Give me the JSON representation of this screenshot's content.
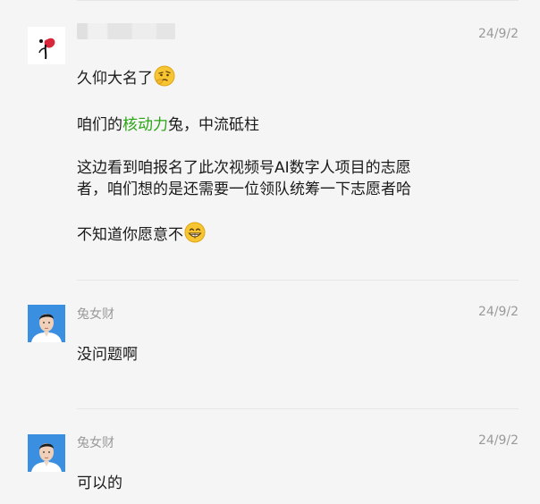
{
  "messages": [
    {
      "sender": "",
      "time": "24/9/2",
      "avatar": "ink-blossom-avatar",
      "paragraphs": [
        {
          "parts": [
            {
              "t": "久仰大名了"
            }
          ],
          "emoji": "thinking-face-emoji"
        },
        {
          "parts": [
            {
              "t": "咱们的"
            },
            {
              "t": "核动力",
              "green": true
            },
            {
              "t": "兔，中流砥柱"
            }
          ]
        },
        {
          "lines": [
            "这边看到咱报名了此次视频号AI数字人项目的志愿",
            "者，咱们想的是还需要一位领队统筹一下志愿者哈"
          ]
        },
        {
          "parts": [
            {
              "t": "不知道你愿意不"
            }
          ],
          "emoji": "grinning-face-emoji"
        }
      ]
    },
    {
      "sender": "兔女财",
      "time": "24/9/2",
      "avatar": "man-portrait-avatar",
      "paragraphs": [
        {
          "parts": [
            {
              "t": "没问题啊"
            }
          ]
        }
      ]
    },
    {
      "sender": "兔女财",
      "time": "24/9/2",
      "avatar": "man-portrait-avatar",
      "paragraphs": [
        {
          "parts": [
            {
              "t": "可以的"
            }
          ]
        }
      ]
    }
  ],
  "colors": {
    "highlight": "#2aa515",
    "meta": "#9a9a9a",
    "text": "#1a1a1a",
    "background": "#f5f5f5"
  }
}
